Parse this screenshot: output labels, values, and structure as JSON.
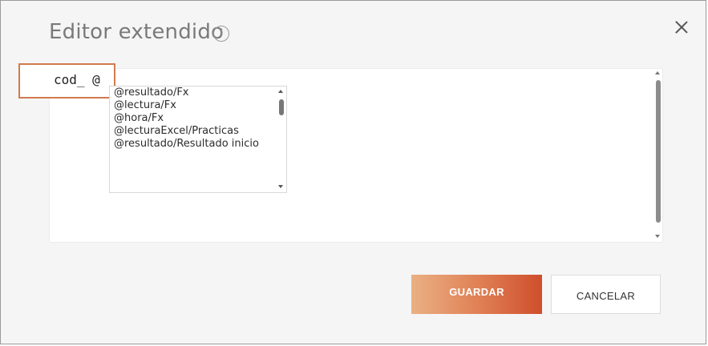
{
  "dialog": {
    "title": "Editor extendido",
    "info_icon": "info-icon",
    "info_glyph": "i",
    "close_icon": "close-icon"
  },
  "editor": {
    "code_text": "cod_ @",
    "highlight_color": "#d27a4e",
    "suggestions": [
      "@resultado/Fx",
      "@lectura/Fx",
      "@hora/Fx",
      "@lecturaExcel/Practicas",
      "@resultado/Resultado inicio"
    ]
  },
  "actions": {
    "save_label": "GUARDAR",
    "cancel_label": "CANCELAR",
    "save_gradient": [
      "#eab084",
      "#df7d52",
      "#cf4e2c"
    ]
  }
}
